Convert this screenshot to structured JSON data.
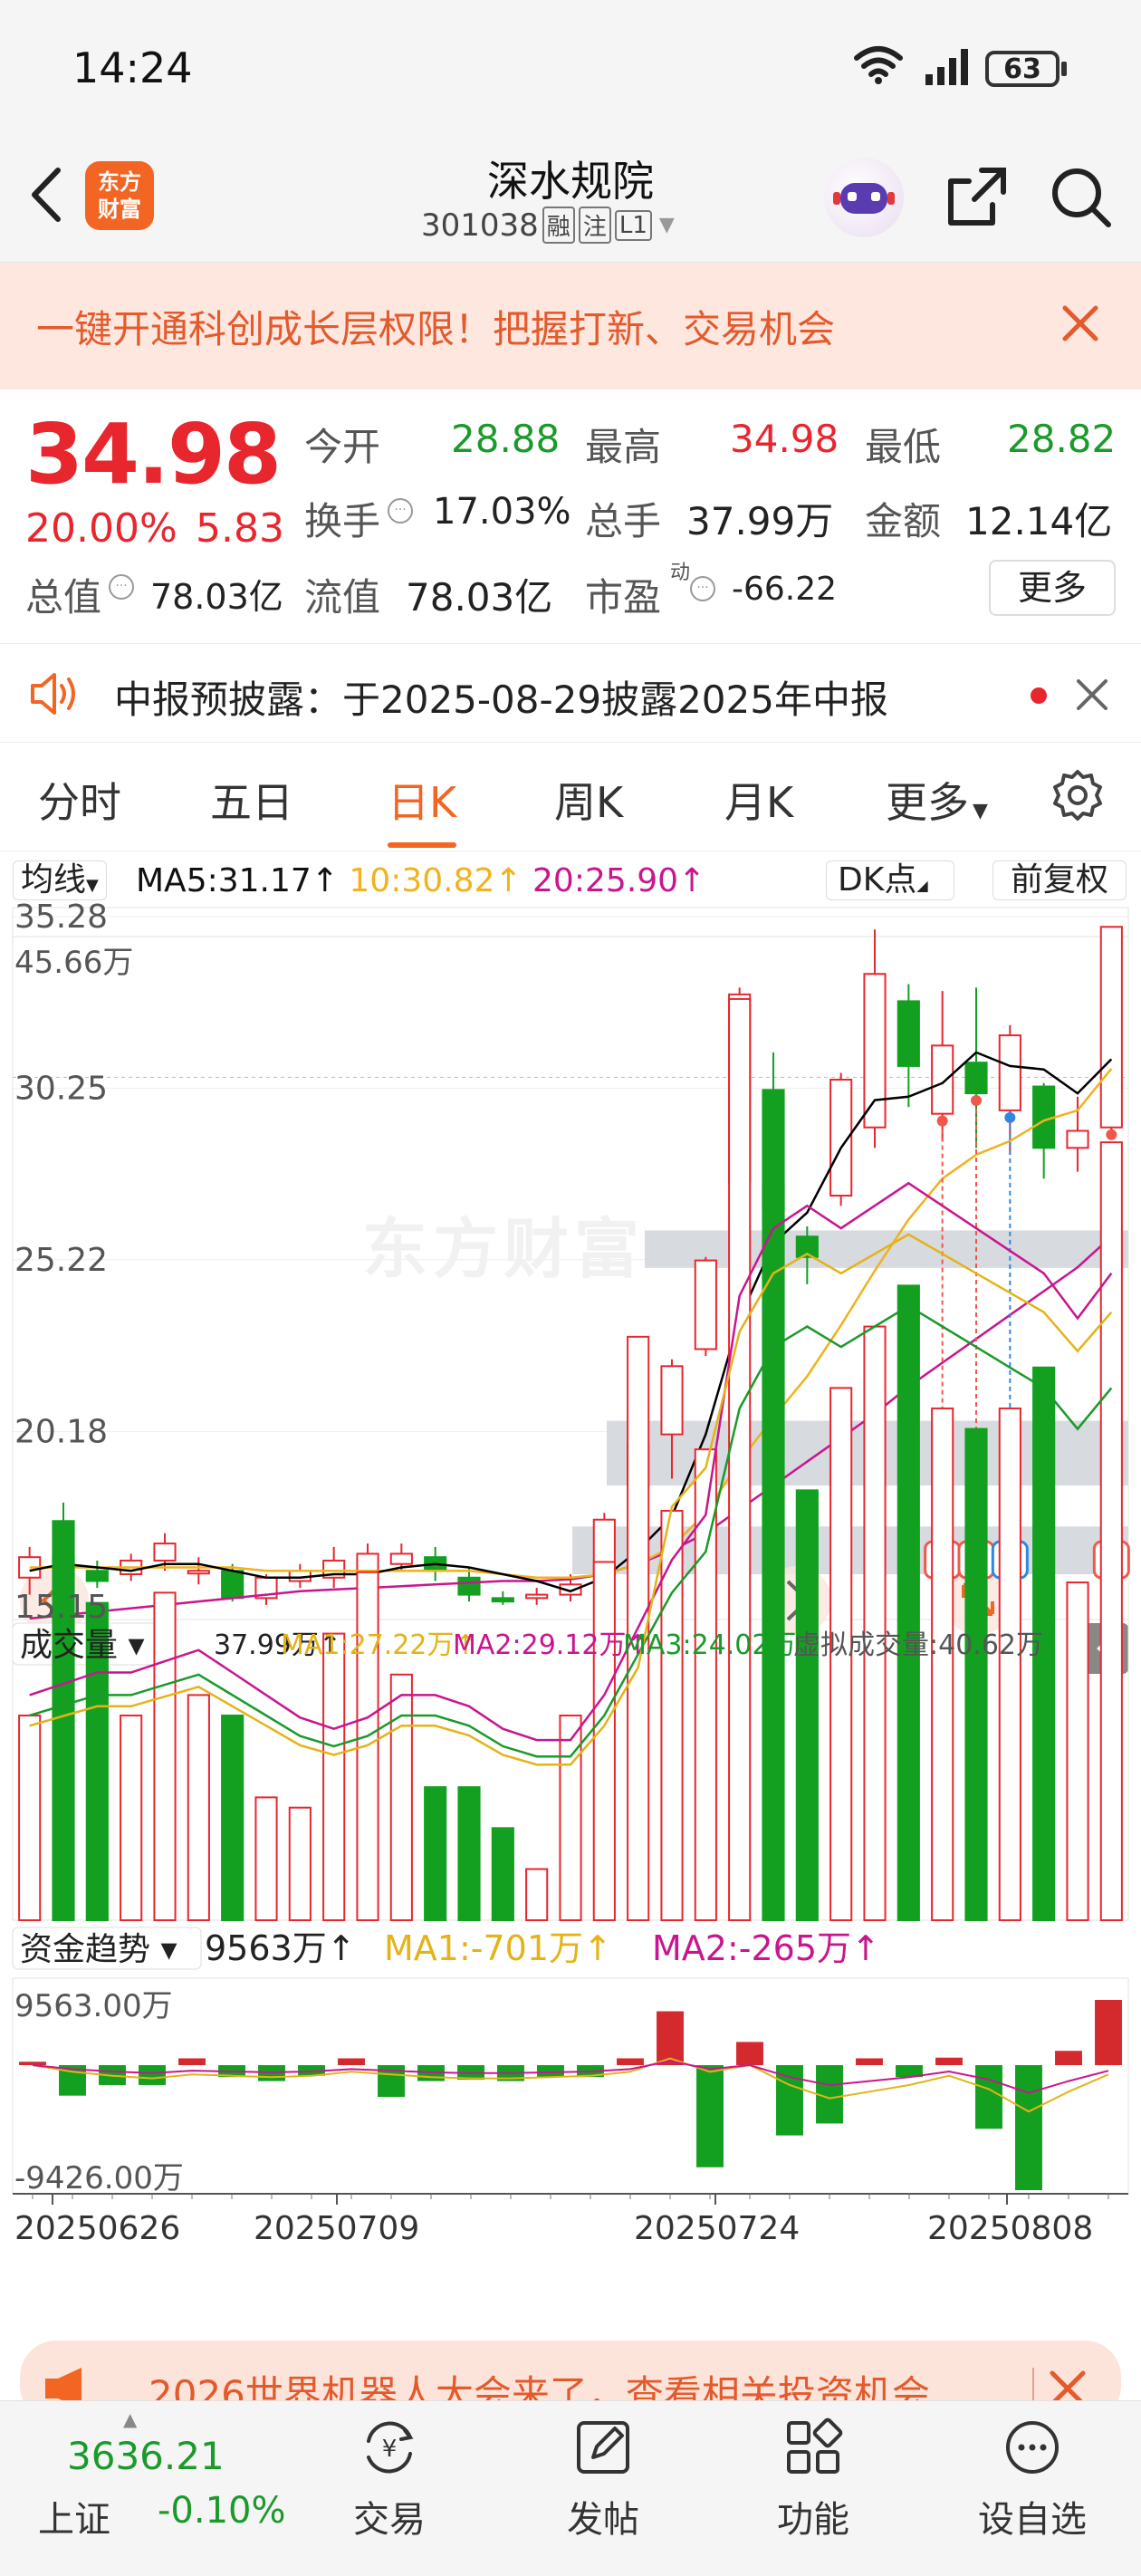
{
  "status_bar": {
    "time": "14:24",
    "battery": "63"
  },
  "header": {
    "logo_text_1": "东方",
    "logo_text_2": "财富",
    "stock_name": "深水规院",
    "stock_code": "301038",
    "tags": [
      "融",
      "注",
      "L1"
    ]
  },
  "banner": {
    "text": "一键开通科创成长层权限！把握打新、交易机会"
  },
  "quote": {
    "price": "34.98",
    "change_pct": "20.00%",
    "change_amt": "5.83",
    "stats": [
      {
        "label": "今开",
        "value": "28.88",
        "color": "green"
      },
      {
        "label": "最高",
        "value": "34.98",
        "color": "red"
      },
      {
        "label": "最低",
        "value": "28.82",
        "color": "green"
      },
      {
        "label": "换手",
        "value": "17.03%",
        "color": "black"
      },
      {
        "label": "总手",
        "value": "37.99万",
        "color": "black"
      },
      {
        "label": "金额",
        "value": "12.14亿",
        "color": "black"
      },
      {
        "label": "总值",
        "value": "78.03亿",
        "color": "black"
      },
      {
        "label": "流值",
        "value": "78.03亿",
        "color": "black"
      },
      {
        "label": "市盈",
        "value": "-66.22",
        "color": "black"
      }
    ],
    "pe_sup": "动",
    "more_label": "更多"
  },
  "notice": {
    "text": "中报预披露：于2025-08-29披露2025年中报"
  },
  "tabs": {
    "items": [
      "分时",
      "五日",
      "日K",
      "周K",
      "月K",
      "更多"
    ],
    "active": "日K"
  },
  "kline": {
    "ma_selector": "均线",
    "ma5": "MA5:31.17",
    "ma10": "10:30.82",
    "ma20": "20:25.90",
    "dk_label": "DK点",
    "adjust_label": "前复权",
    "watermark": "东方财富",
    "y_ticks": [
      "35.28",
      "30.25",
      "25.22",
      "20.18",
      "15.15"
    ]
  },
  "volume": {
    "selector": "成交量",
    "value": "37.99万",
    "ma1": "MA1:27.22万",
    "ma2": "MA2:29.12万",
    "ma3": "MA3:24.02万",
    "virtual": "虚拟成交量:40.62万",
    "y_max": "45.66万"
  },
  "fund": {
    "selector": "资金趋势",
    "value": "9563万",
    "ma1": "MA1:-701万",
    "ma2": "MA2:-265万",
    "y_max": "9563.00万",
    "y_min": "-9426.00万"
  },
  "dates": [
    "20250626",
    "20250709",
    "20250724",
    "20250808"
  ],
  "ad": {
    "text": "2026世界机器人大会来了，查看相关投资机会"
  },
  "bottom": {
    "index_value": "3636.21",
    "index_name": "上证",
    "index_change": "-0.10%",
    "items": [
      "交易",
      "发帖",
      "功能",
      "设自选"
    ]
  },
  "colors": {
    "up": "#e8262e",
    "down": "#13a020",
    "ma5": "#000000",
    "ma10": "#f0b21e",
    "ma20": "#c8168f"
  },
  "chart_data": {
    "type": "candlestick",
    "ylim": [
      15.15,
      35.28
    ],
    "candles": [
      {
        "o": 15.9,
        "c": 16.5,
        "h": 16.8,
        "l": 15.4
      },
      {
        "o": 16.5,
        "c": 16.2,
        "h": 18.1,
        "l": 15.8
      },
      {
        "o": 16.1,
        "c": 15.8,
        "h": 16.4,
        "l": 15.6
      },
      {
        "o": 16.0,
        "c": 16.4,
        "h": 16.6,
        "l": 15.8
      },
      {
        "o": 16.4,
        "c": 16.9,
        "h": 17.2,
        "l": 16.1
      },
      {
        "o": 16.1,
        "c": 16.1,
        "h": 16.5,
        "l": 15.7
      },
      {
        "o": 16.1,
        "c": 15.3,
        "h": 16.3,
        "l": 15.2
      },
      {
        "o": 15.3,
        "c": 15.9,
        "h": 16.0,
        "l": 15.1
      },
      {
        "o": 15.8,
        "c": 16.1,
        "h": 16.3,
        "l": 15.6
      },
      {
        "o": 15.9,
        "c": 16.4,
        "h": 16.8,
        "l": 15.6
      },
      {
        "o": 15.9,
        "c": 16.6,
        "h": 16.9,
        "l": 15.2
      },
      {
        "o": 16.3,
        "c": 16.6,
        "h": 16.9,
        "l": 16.1
      },
      {
        "o": 16.5,
        "c": 16.1,
        "h": 16.8,
        "l": 15.8
      },
      {
        "o": 15.9,
        "c": 15.4,
        "h": 16.2,
        "l": 15.2
      },
      {
        "o": 15.3,
        "c": 15.2,
        "h": 15.5,
        "l": 15.1
      },
      {
        "o": 15.3,
        "c": 15.4,
        "h": 15.6,
        "l": 15.1
      },
      {
        "o": 15.4,
        "c": 15.7,
        "h": 16.0,
        "l": 15.2
      },
      {
        "o": 16.0,
        "c": 17.6,
        "h": 17.8,
        "l": 15.9
      },
      {
        "o": 18.6,
        "c": 19.8,
        "h": 19.9,
        "l": 18.3
      },
      {
        "o": 20.1,
        "c": 22.1,
        "h": 22.3,
        "l": 18.8
      },
      {
        "o": 22.6,
        "c": 25.2,
        "h": 25.3,
        "l": 22.4
      },
      {
        "o": 27.5,
        "c": 33.0,
        "h": 33.2,
        "l": 27.3
      },
      {
        "o": 30.2,
        "c": 26.7,
        "h": 31.3,
        "l": 26.5
      },
      {
        "o": 25.9,
        "c": 25.3,
        "h": 26.2,
        "l": 24.5
      },
      {
        "o": 27.1,
        "c": 30.5,
        "h": 30.7,
        "l": 26.8
      },
      {
        "o": 29.1,
        "c": 33.6,
        "h": 34.9,
        "l": 28.5
      },
      {
        "o": 32.8,
        "c": 30.9,
        "h": 33.3,
        "l": 29.7
      },
      {
        "o": 29.5,
        "c": 31.5,
        "h": 33.1,
        "l": 28.7
      },
      {
        "o": 31.0,
        "c": 30.1,
        "h": 33.2,
        "l": 28.5
      },
      {
        "o": 29.6,
        "c": 31.8,
        "h": 32.1,
        "l": 28.3
      },
      {
        "o": 30.3,
        "c": 28.5,
        "h": 30.4,
        "l": 27.6
      },
      {
        "o": 28.5,
        "c": 29.0,
        "h": 30.0,
        "l": 27.8
      },
      {
        "o": 29.1,
        "c": 34.98,
        "h": 34.98,
        "l": 28.82
      }
    ],
    "ma5": [
      16.1,
      16.3,
      16.2,
      16.1,
      16.3,
      16.3,
      16.1,
      15.9,
      15.9,
      16.0,
      16.0,
      16.2,
      16.3,
      16.2,
      16.0,
      15.8,
      15.5,
      15.9,
      16.7,
      17.7,
      20.1,
      23.5,
      25.7,
      26.6,
      28.5,
      29.9,
      30.0,
      30.4,
      31.3,
      30.9,
      30.8,
      30.1,
      31.1
    ],
    "ma10": [
      16.2,
      16.2,
      16.2,
      16.2,
      16.2,
      16.2,
      16.2,
      16.1,
      16.1,
      16.1,
      16.1,
      16.1,
      16.1,
      16.1,
      16.0,
      15.9,
      15.9,
      16.0,
      16.3,
      16.8,
      17.8,
      19.3,
      20.6,
      21.8,
      23.3,
      24.9,
      26.4,
      27.6,
      28.3,
      28.7,
      29.3,
      29.6,
      30.82
    ],
    "ma20": [
      14.7,
      14.8,
      14.9,
      15.0,
      15.1,
      15.2,
      15.3,
      15.4,
      15.5,
      15.55,
      15.6,
      15.65,
      15.7,
      15.75,
      15.8,
      15.8,
      15.85,
      16.0,
      16.3,
      16.7,
      17.2,
      17.9,
      18.6,
      19.3,
      20.0,
      20.7,
      21.5,
      22.2,
      22.9,
      23.6,
      24.3,
      25.0,
      25.9
    ],
    "volume": [
      10,
      19.5,
      15.5,
      10,
      16,
      11,
      10,
      6,
      5.5,
      14,
      17,
      12,
      6.5,
      6.5,
      4.5,
      2.5,
      10,
      17.5,
      28.5,
      20,
      23,
      45,
      36,
      21,
      26,
      29,
      31,
      25,
      24,
      25,
      27,
      16.5,
      38
    ],
    "vol_ma": [
      10,
      10.5,
      11,
      11,
      11.5,
      12,
      11,
      10,
      9,
      8.5,
      9,
      10,
      10,
      9.5,
      8.5,
      8,
      8,
      10,
      13,
      16,
      18,
      25,
      28,
      29,
      28,
      29,
      30,
      29,
      28,
      27,
      26,
      24,
      26
    ],
    "fund": [
      500,
      -2300,
      -1500,
      -1500,
      1000,
      -900,
      -1200,
      -800,
      1000,
      -2400,
      -1200,
      -1100,
      -1200,
      -900,
      -900,
      1000,
      7900,
      -7700,
      3400,
      -5300,
      -4400,
      1000,
      -900,
      1100,
      -4800,
      -9426,
      2100,
      9563
    ],
    "fund_ma1": [
      0,
      -500,
      -800,
      -1000,
      -700,
      -800,
      -900,
      -800,
      -500,
      -700,
      -900,
      -1000,
      -1000,
      -900,
      -800,
      -500,
      1000,
      -500,
      0,
      -1500,
      -2500,
      -2000,
      -1500,
      -800,
      -1800,
      -3500,
      -2000,
      -701
    ],
    "markers": [
      {
        "idx": 27,
        "label": "B"
      },
      {
        "idx": 28,
        "label": "B"
      },
      {
        "idx": 29,
        "label": "S"
      },
      {
        "idx": 32,
        "label": "B"
      }
    ]
  }
}
